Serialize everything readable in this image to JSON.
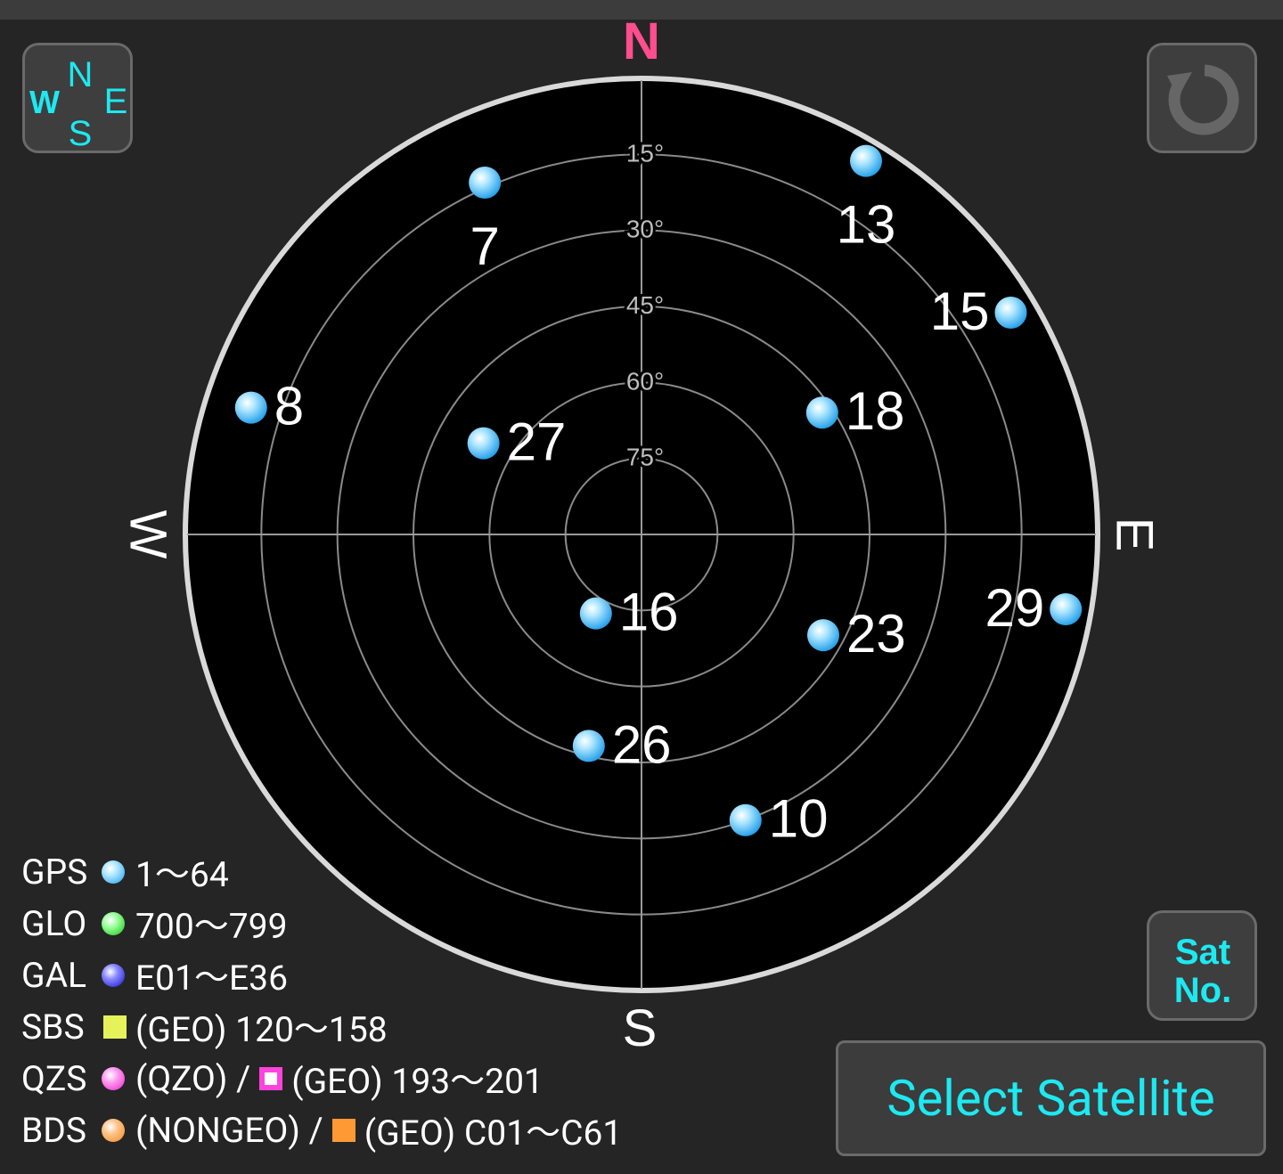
{
  "compass": {
    "north": "N",
    "south": "S",
    "east": "E",
    "west": "W"
  },
  "elevation_labels": [
    "15°",
    "30°",
    "45°",
    "60°",
    "75°"
  ],
  "satellites": [
    {
      "id": "7",
      "system": "GPS",
      "azimuth": 336,
      "elevation": 14
    },
    {
      "id": "13",
      "system": "GPS",
      "azimuth": 31,
      "elevation": 4
    },
    {
      "id": "15",
      "system": "GPS",
      "azimuth": 59,
      "elevation": 5
    },
    {
      "id": "8",
      "system": "GPS",
      "azimuth": 288,
      "elevation": 9
    },
    {
      "id": "18",
      "system": "GPS",
      "azimuth": 56,
      "elevation": 47
    },
    {
      "id": "27",
      "system": "GPS",
      "azimuth": 300,
      "elevation": 54
    },
    {
      "id": "16",
      "system": "GPS",
      "azimuth": 210,
      "elevation": 72
    },
    {
      "id": "23",
      "system": "GPS",
      "azimuth": 119,
      "elevation": 49
    },
    {
      "id": "29",
      "system": "GPS",
      "azimuth": 100,
      "elevation": 5
    },
    {
      "id": "26",
      "system": "GPS",
      "azimuth": 194,
      "elevation": 47
    },
    {
      "id": "10",
      "system": "GPS",
      "azimuth": 160,
      "elevation": 30
    }
  ],
  "colors": {
    "GPS": "#29b6f6",
    "GLO": "#22dd22",
    "GAL": "#2222dd",
    "SBS": "#e6f25a",
    "QZS": "#ff44dd",
    "BDS": "#ff9933",
    "north": "#ff4d8e",
    "accent": "#1de9f1"
  },
  "legend": [
    {
      "system": "GPS",
      "color": "GPS",
      "range": "1〜64"
    },
    {
      "system": "GLO",
      "color": "GLO",
      "range": "700〜799"
    },
    {
      "system": "GAL",
      "color": "GAL",
      "range": "E01〜E36"
    },
    {
      "system": "SBS",
      "color": "SBS",
      "range": "(GEO) 120〜158"
    },
    {
      "system": "QZS",
      "color": "QZS",
      "range_a": "(QZO) /",
      "range_b": "(GEO) 193〜201"
    },
    {
      "system": "BDS",
      "color": "BDS",
      "range_a": "(NONGEO) /",
      "range_b": "(GEO) C01〜C61"
    }
  ],
  "buttons": {
    "compass_icon_letters": {
      "n": "N",
      "s": "S",
      "e": "E",
      "w": "W"
    },
    "sat_no_line1": "Sat",
    "sat_no_line2": "No.",
    "select_satellite": "Select Satellite"
  }
}
